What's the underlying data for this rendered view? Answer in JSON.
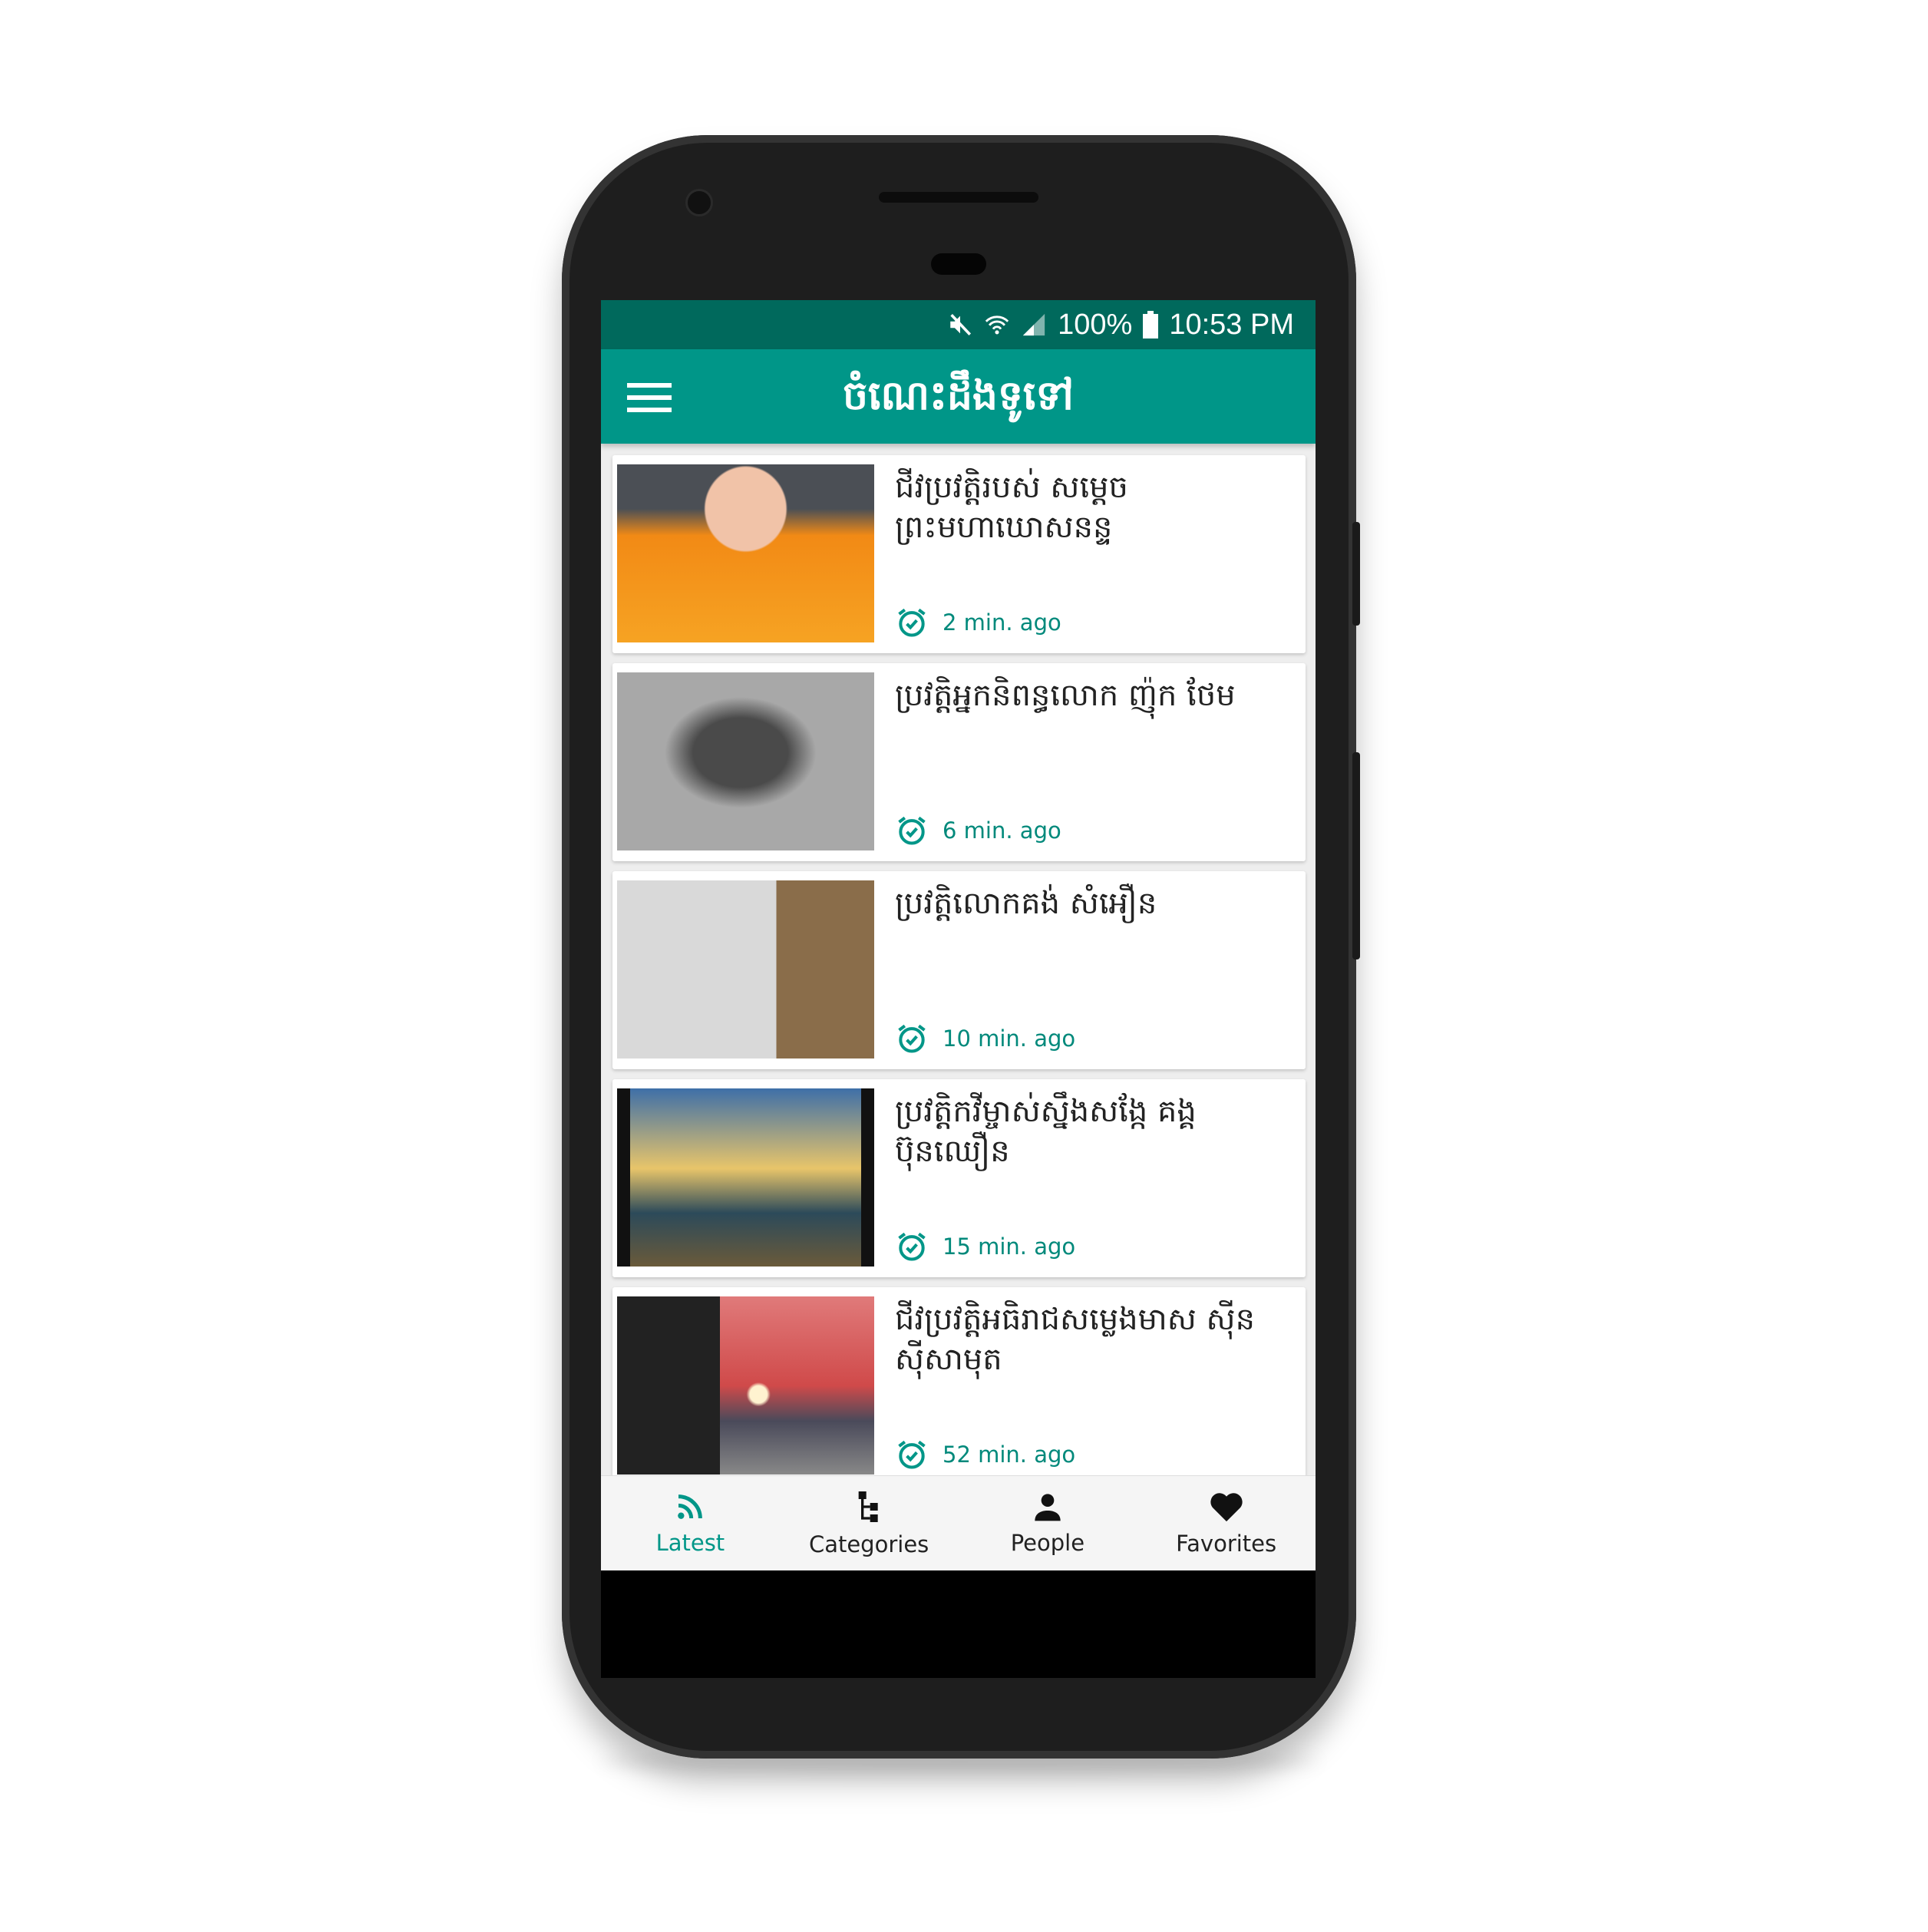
{
  "status_bar": {
    "battery": "100%",
    "time": "10:53 PM",
    "icons": [
      "mute-icon",
      "wifi-icon",
      "signal-icon",
      "battery-icon"
    ]
  },
  "toolbar": {
    "title": "ចំណេះដឹងទូទៅ",
    "menu_icon": "hamburger-icon"
  },
  "colors": {
    "primary": "#009688",
    "primary_dark": "#00695c",
    "accent_text": "#00897b"
  },
  "articles": [
    {
      "title": "ជីវប្រវត្តិរបស់ សម្តេចព្រះមហាឃោសនន្ទ",
      "time": "2 min. ago"
    },
    {
      "title": "ប្រវត្តិអ្នកនិពន្ធលោក ញ៉ុក ថែម",
      "time": "6 min. ago"
    },
    {
      "title": "ប្រវត្តិលោកគង់ សំអឿន",
      "time": "10 min. ago"
    },
    {
      "title": "ប្រវត្តិកវីម្ចាស់ស្នឹងសង្កែ គង្គ ប៊ុនឈឿន",
      "time": "15 min. ago"
    },
    {
      "title": "ជីវប្រវត្តិអធិរាជសម្លេងមាស ស៊ីន ស៊ីសាមុត",
      "time": "52 min. ago"
    }
  ],
  "bottom_nav": [
    {
      "label": "Latest",
      "icon": "rss-icon",
      "active": true
    },
    {
      "label": "Categories",
      "icon": "tree-icon",
      "active": false
    },
    {
      "label": "People",
      "icon": "person-icon",
      "active": false
    },
    {
      "label": "Favorites",
      "icon": "heart-icon",
      "active": false
    }
  ]
}
